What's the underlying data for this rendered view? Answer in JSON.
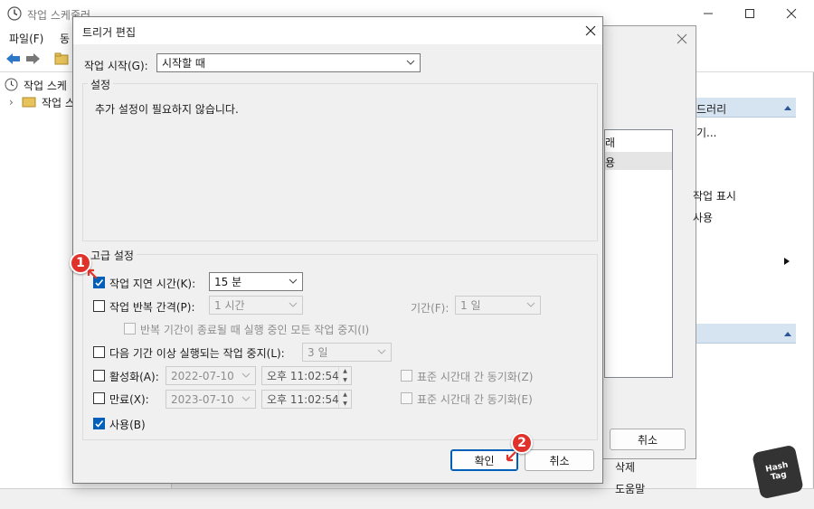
{
  "main_window": {
    "title": "작업 스케줄러",
    "menu": [
      "파일(F)",
      "동"
    ],
    "tree": [
      "작업 스케",
      "작업 스"
    ],
    "dialog2_buttons": {
      "cancel": "취소"
    },
    "list_items": [
      "래",
      "용"
    ],
    "actions": [
      "드러리",
      "기...",
      "작업 표시",
      "사용",
      "삭제",
      "도움말"
    ]
  },
  "dialog": {
    "title": "트리거 편집",
    "start_task_label": "작업 시작(G):",
    "start_task_value": "시작할 때",
    "settings_group": "설정",
    "settings_text": "추가 설정이 필요하지 않습니다.",
    "advanced_group": "고급 설정",
    "delay": {
      "label": "작업 지연 시간(K):",
      "checked": true,
      "value": "15 분"
    },
    "repeat": {
      "label": "작업 반복 간격(P):",
      "checked": false,
      "value": "1 시간",
      "duration_label": "기간(F):",
      "duration_value": "1 일"
    },
    "stop_running": {
      "label": "반복 기간이 종료될 때 실행 중인 모든 작업 중지(I)"
    },
    "stop_longer": {
      "label": "다음 기간 이상 실행되는 작업 중지(L):",
      "checked": false,
      "value": "3 일"
    },
    "activate": {
      "label": "활성화(A):",
      "date": "2022-07-10",
      "time": "오후 11:02:54",
      "sync_label": "표준 시간대 간 동기화(Z)"
    },
    "expire": {
      "label": "만료(X):",
      "date": "2023-07-10",
      "time": "오후 11:02:54",
      "sync_label": "표준 시간대 간 동기화(E)"
    },
    "enabled": {
      "label": "사용(B)",
      "checked": true
    },
    "ok_label": "확인",
    "cancel_label": "취소"
  },
  "annotations": {
    "badge1": "1",
    "badge2": "2"
  },
  "watermark": {
    "line1": "Hash",
    "line2": "Tag"
  },
  "colors": {
    "accent": "#005fb8",
    "badge": "#e0322b",
    "action_header": "#d6e4f2"
  },
  "icons": [
    "clock-icon",
    "back-arrow-icon",
    "forward-arrow-icon",
    "folder-icon",
    "chevron-down-icon",
    "close-icon",
    "minimize-icon",
    "maximize-icon",
    "spin-up-icon",
    "spin-down-icon",
    "checkmark-icon"
  ]
}
